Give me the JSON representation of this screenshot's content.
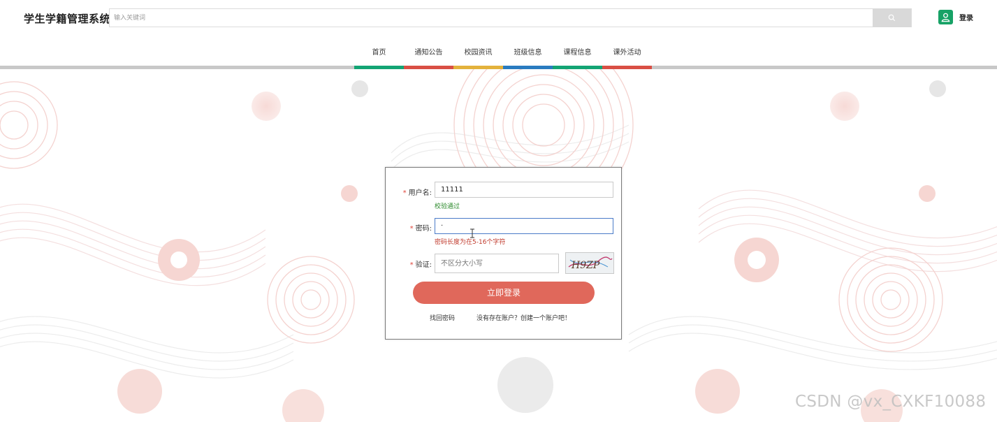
{
  "header": {
    "title": "学生学籍管理系统",
    "search_placeholder": "输入关键词",
    "login_label": "登录"
  },
  "nav": {
    "items": [
      {
        "label": "首页",
        "color": "#13a474"
      },
      {
        "label": "通知公告",
        "color": "#d94f45"
      },
      {
        "label": "校园资讯",
        "color": "#e3b23c"
      },
      {
        "label": "班级信息",
        "color": "#2a7bc0"
      },
      {
        "label": "课程信息",
        "color": "#13a474"
      },
      {
        "label": "课外活动",
        "color": "#d94f45"
      }
    ]
  },
  "login_form": {
    "username_label": "用户名:",
    "username_value": "11111",
    "username_ok": "校验通过",
    "password_label": "密码:",
    "password_value": "·",
    "password_error": "密码长度为在5-16个字符",
    "verify_label": "验证:",
    "verify_placeholder": "不区分大小写",
    "captcha_text": "H9ZP",
    "submit_label": "立即登录",
    "forgot_link": "找回密码",
    "register_link": "没有存在账户？创建一个账户吧！"
  },
  "watermark": "CSDN @vx_CXKF10088",
  "colors": {
    "accent_green": "#17a266",
    "button_red": "#e0685b"
  }
}
